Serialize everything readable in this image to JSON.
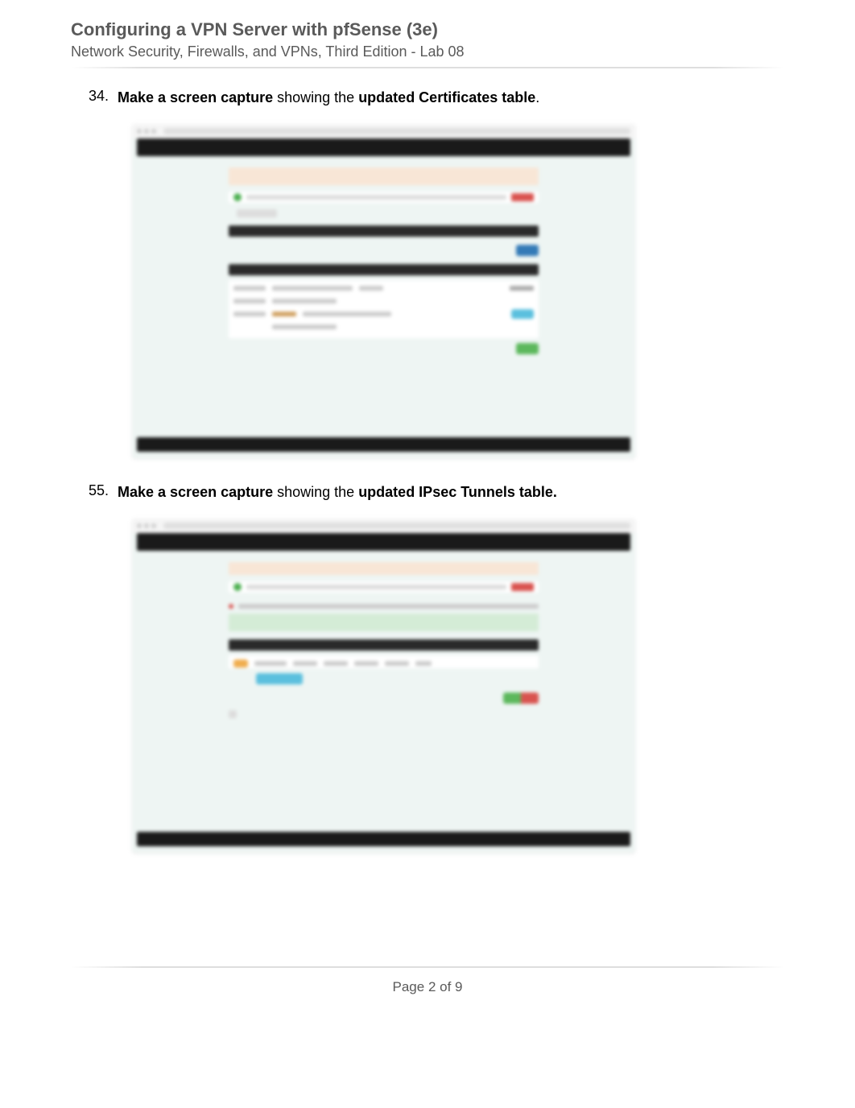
{
  "header": {
    "title": "Configuring a VPN Server with pfSense (3e)",
    "subtitle": "Network Security, Firewalls, and VPNs, Third Edition - Lab 08"
  },
  "items": [
    {
      "number": "34.",
      "bold1": "Make a screen capture",
      "mid": " showing the ",
      "bold2": "updated Certificates table",
      "tail": "."
    },
    {
      "number": "55.",
      "bold1": "Make a screen capture",
      "mid": " showing the ",
      "bold2": "updated IPsec Tunnels table.",
      "tail": ""
    }
  ],
  "footer": {
    "pageText": "Page 2 of 9"
  }
}
